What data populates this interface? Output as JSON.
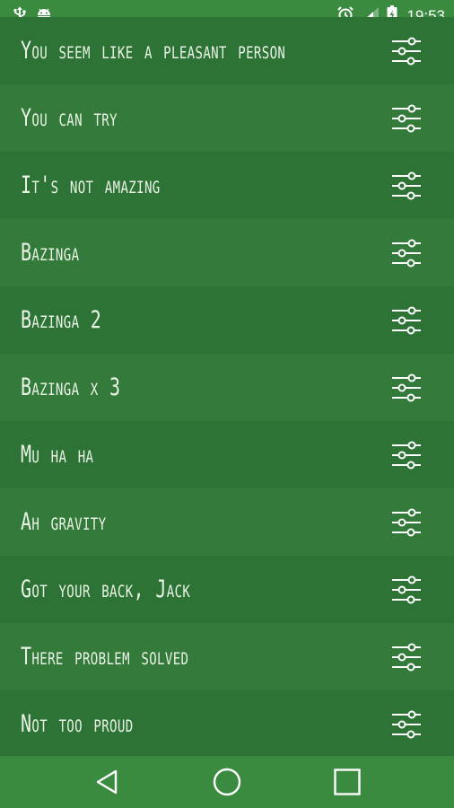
{
  "status_bar": {
    "time": "19:53",
    "left_icons": [
      "usb-icon",
      "android-icon"
    ],
    "right_icons": [
      "alarm-icon",
      "signal-icon",
      "battery-charging-icon"
    ]
  },
  "sound_list": {
    "items": [
      {
        "label": "You seem like a pleasant person"
      },
      {
        "label": "You can try"
      },
      {
        "label": "It's not amazing"
      },
      {
        "label": "Bazinga"
      },
      {
        "label": "Bazinga 2"
      },
      {
        "label": "Bazinga x 3"
      },
      {
        "label": "Mu ha ha"
      },
      {
        "label": "Ah gravity"
      },
      {
        "label": "Got your back, Jack"
      },
      {
        "label": "There problem solved"
      },
      {
        "label": "Not too proud"
      }
    ],
    "item_icon": "settings-sliders-icon"
  },
  "nav_bar": {
    "buttons": [
      "back-icon",
      "home-icon",
      "recents-icon"
    ]
  },
  "colors": {
    "background": "#2e7336",
    "row_alt": "#347a3b",
    "bars": "#3a8a3f",
    "text": "#e9f3e6"
  }
}
